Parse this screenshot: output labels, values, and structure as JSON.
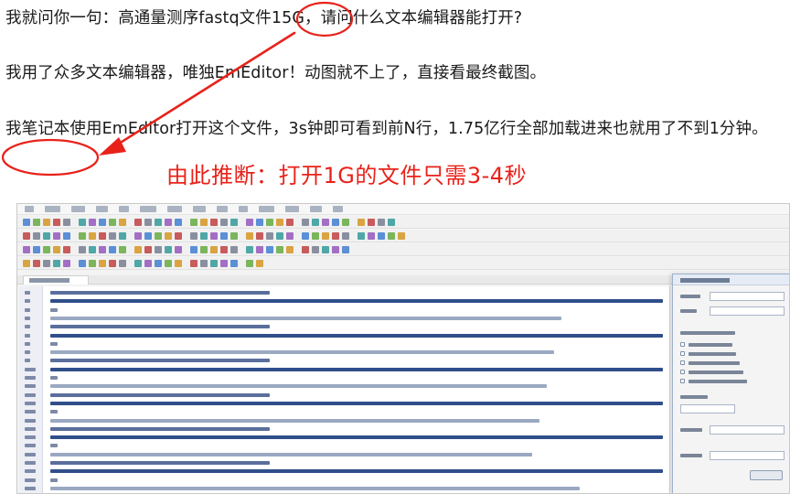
{
  "article": {
    "p1": "我就问你一句：高通量测序fastq文件15G，请问什么文本编辑器能打开?",
    "p2": "我用了众多文本编辑器，唯独EmEditor！动图就不上了，直接看最终截图。",
    "p3": "我笔记本使用EmEditor打开这个文件，3s钟即可看到前N行，1.75亿行全部加载进来也就用了不到1分钟。",
    "annotation": "由此推断：打开1G的文件只需3-4秒"
  },
  "colors": {
    "text": "#1a1a1a",
    "annotation_red": "#e8221a",
    "editor_gutter": "#edeff5"
  },
  "icons": [
    "circle-highlight",
    "red-arrow"
  ]
}
